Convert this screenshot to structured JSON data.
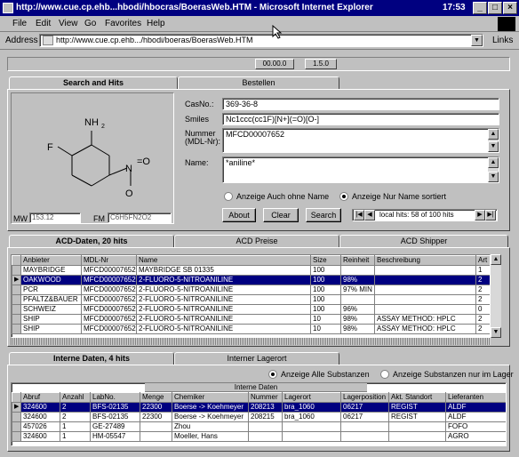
{
  "window": {
    "title": "http://www.cue.cp.ehb...hbodi/hbocras/BoerasWeb.HTM - Microsoft Internet Explorer",
    "clock": "17:53"
  },
  "menu": [
    "File",
    "Edit",
    "View",
    "Go",
    "Favorites",
    "Help"
  ],
  "address": {
    "label": "Address",
    "value": "http://www.cue.cp.ehb.../hbodi/boeras/BoerasWeb.HTM",
    "links_label": "Links"
  },
  "status_top": {
    "a": "00.00.0",
    "b": "1.5.0"
  },
  "top_tabs": [
    "Search and Hits",
    "Bestellen"
  ],
  "structure": {
    "mw_label": "MW",
    "mw_value": "153.12",
    "fm_label": "FM",
    "fm_value": "C6H5FN2O2"
  },
  "form": {
    "casno_label": "CasNo.:",
    "casno_value": "369-36-8",
    "smiles_label": "Smiles",
    "smiles_value": "Nc1ccc(cc1F)[N+](=O)[O-]",
    "nummer_label": "Nummer (MDL-Nr):",
    "nummer_value": "MFCD00007652",
    "name_label": "Name:",
    "name_value": "*aniline*",
    "radio1": "Anzeige Auch ohne Name",
    "radio2": "Anzeige Nur Name sortiert",
    "about": "About",
    "clear": "Clear",
    "search": "Search",
    "hits_text": "local hits: 58 of 100 hits"
  },
  "acd_tabs": [
    "ACD-Daten, 20 hits",
    "ACD Preise",
    "ACD Shipper"
  ],
  "acd_table": {
    "headers": [
      "Anbieter",
      "MDL-Nr",
      "Name",
      "Size",
      "Reinheit",
      "Beschreibung",
      "Art"
    ],
    "rows": [
      [
        "MAYBRIDGE",
        "MFCD00007652",
        "MAYBRIDGE SB 01335",
        "100",
        "",
        "",
        "1"
      ],
      [
        "OAKWOOD",
        "MFCD00007652",
        "2-FLUORO-5-NITROANILINE",
        "100",
        "98%",
        "",
        "2"
      ],
      [
        "PCR",
        "MFCD00007652",
        "2-FLUORO-5-NITROANILINE",
        "100",
        "97% MIN",
        "",
        "2"
      ],
      [
        "PFALTZ&BAUER",
        "MFCD00007652",
        "2-FLUORO-5-NITROANILINE",
        "100",
        "",
        "",
        "2"
      ],
      [
        "SCHWEIZ",
        "MFCD00007652",
        "2-FLUORO-5-NITROANILINE",
        "100",
        "96%",
        "",
        "0"
      ],
      [
        "SHIP",
        "MFCD00007652",
        "2-FLUORO-5-NITROANILINE",
        "10",
        "98%",
        "ASSAY METHOD: HPLC",
        "2"
      ],
      [
        "SHIP",
        "MFCD00007652",
        "2-FLUORO-5-NITROANILINE",
        "10",
        "98%",
        "ASSAY METHOD: HPLC",
        "2"
      ]
    ]
  },
  "int_tabs": [
    "Interne Daten, 4 hits",
    "Interner Lagerort"
  ],
  "int_radio1": "Anzeige Alle Substanzen",
  "int_radio2": "Anzeige Substanzen nur im Lager",
  "int_table": {
    "caption": "Interne Daten",
    "headers": [
      "Abruf",
      "Anzahl",
      "LabNo.",
      "Menge",
      "Chemiker",
      "Nummer",
      "Lagerort",
      "Lagerposition",
      "Akt. Standort",
      "Lieferanten"
    ],
    "rows": [
      [
        "324600",
        "2",
        "BFS-02135",
        "22300",
        "Boerse -> Koehmeyer",
        "208213",
        "bra_1060",
        "06217",
        "REGIST",
        "ALDF"
      ],
      [
        "324600",
        "2",
        "BFS-02135",
        "22300",
        "Boerse -> Koehmeyer",
        "208215",
        "bra_1060",
        "06217",
        "REGIST",
        "ALDF"
      ],
      [
        "457026",
        "1",
        "GE-27489",
        "",
        "Zhou",
        "",
        "",
        "",
        "",
        "FOFO"
      ],
      [
        "324600",
        "1",
        "HM-05547",
        "",
        "Moeller, Hans",
        "",
        "",
        "",
        "",
        "AGRO"
      ]
    ]
  }
}
